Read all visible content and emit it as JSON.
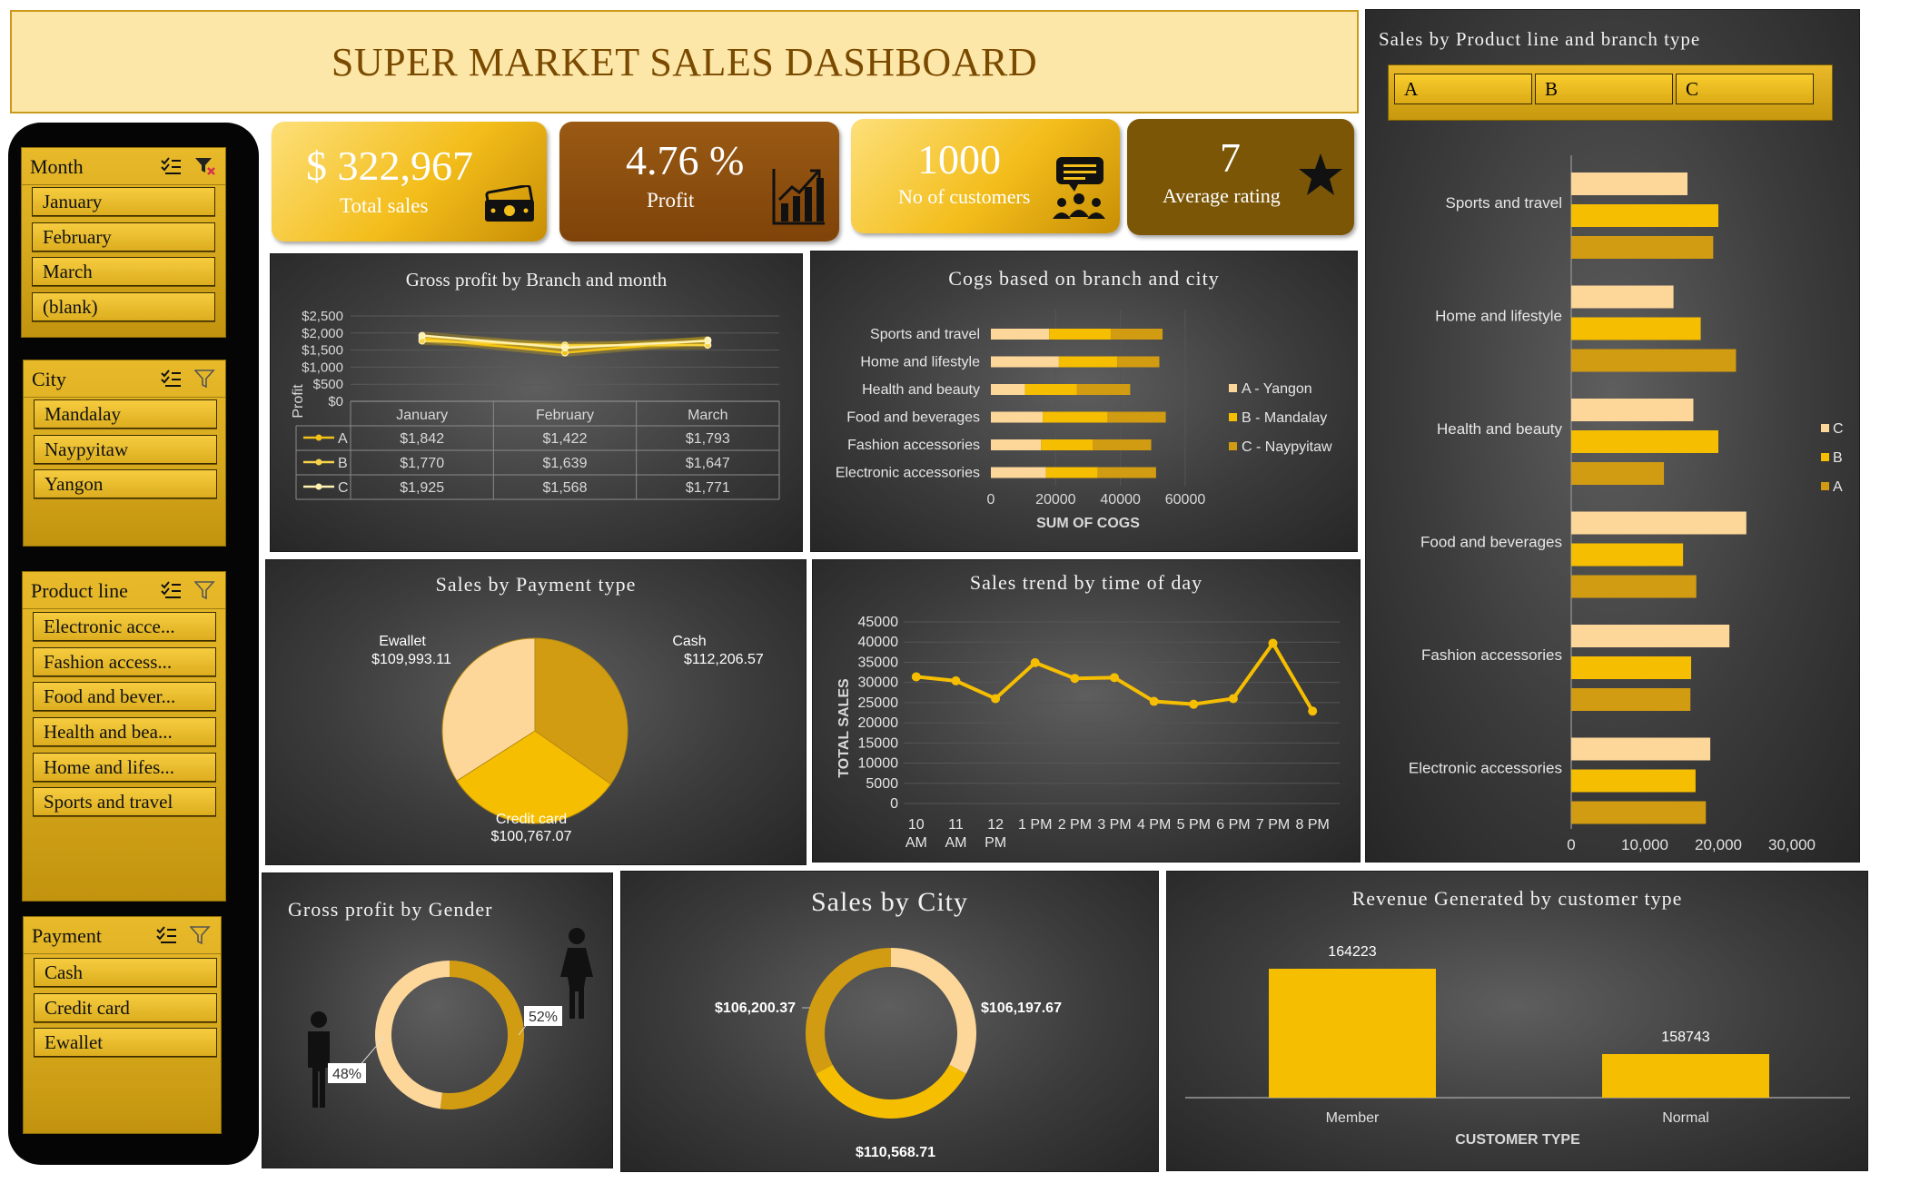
{
  "title": "SUPER MARKET SALES DASHBOARD",
  "slicers": {
    "month": {
      "title": "Month",
      "items": [
        "January",
        "February",
        "March",
        "(blank)"
      ]
    },
    "city": {
      "title": "City",
      "items": [
        "Mandalay",
        "Naypyitaw",
        "Yangon"
      ]
    },
    "product_line": {
      "title": "Product line",
      "items": [
        "Electronic acce...",
        "Fashion access...",
        "Food and bever...",
        "Health and bea...",
        "Home and lifes...",
        "Sports and travel"
      ]
    },
    "payment": {
      "title": "Payment",
      "items": [
        "Cash",
        "Credit card",
        "Ewallet"
      ]
    }
  },
  "kpis": {
    "total_sales": {
      "value": "$ 322,967",
      "label": "Total sales"
    },
    "profit": {
      "value": "4.76 %",
      "label": "Profit"
    },
    "customers": {
      "value": "1000",
      "label": "No of customers"
    },
    "rating": {
      "value": "7",
      "label": "Average rating"
    }
  },
  "colors": {
    "light": "#fdd79a",
    "mid": "#f6be00",
    "dark": "#d29c12",
    "title_text": "#7a4a00"
  },
  "chart_data": [
    {
      "id": "gross_profit_branch_month",
      "type": "line",
      "title": "Gross profit by Branch and month",
      "ylabel": "Profit",
      "categories": [
        "January",
        "February",
        "March"
      ],
      "yticks": [
        "$2,500",
        "$2,000",
        "$1,500",
        "$1,000",
        "$500",
        "$0"
      ],
      "ylim": [
        0,
        2500
      ],
      "series": [
        {
          "name": "A",
          "values": [
            1842,
            1422,
            1793
          ],
          "labels": [
            "$1,842",
            "$1,422",
            "$1,793"
          ]
        },
        {
          "name": "B",
          "values": [
            1770,
            1639,
            1647
          ],
          "labels": [
            "$1,770",
            "$1,639",
            "$1,647"
          ]
        },
        {
          "name": "C",
          "values": [
            1925,
            1568,
            1771
          ],
          "labels": [
            "$1,925",
            "$1,568",
            "$1,771"
          ]
        }
      ]
    },
    {
      "id": "cogs_branch_city",
      "type": "bar",
      "orientation": "horizontal",
      "stacked": true,
      "title": "Cogs based on branch and city",
      "xlabel": "SUM OF COGS",
      "categories": [
        "Sports and travel",
        "Home and lifestyle",
        "Health and beauty",
        "Food and beverages",
        "Fashion accessories",
        "Electronic accessories"
      ],
      "xticks": [
        "0",
        "20000",
        "40000",
        "60000"
      ],
      "xlim": [
        0,
        60000
      ],
      "legend_position": "right",
      "series": [
        {
          "name": "A - Yangon",
          "values": [
            18000,
            21000,
            10500,
            16000,
            15500,
            17000
          ]
        },
        {
          "name": "B - Mandalay",
          "values": [
            19000,
            18000,
            16000,
            20000,
            16000,
            16000
          ]
        },
        {
          "name": "C - Naypyitaw",
          "values": [
            16000,
            13000,
            16500,
            18000,
            18000,
            18000
          ]
        }
      ]
    },
    {
      "id": "sales_payment_type",
      "type": "pie",
      "title": "Sales by Payment type",
      "slices": [
        {
          "name": "Cash",
          "value": 112206.57,
          "label": "$112,206.57"
        },
        {
          "name": "Credit card",
          "value": 100767.07,
          "label": "$100,767.07"
        },
        {
          "name": "Ewallet",
          "value": 109993.11,
          "label": "$109,993.11"
        }
      ]
    },
    {
      "id": "sales_trend_time",
      "type": "line",
      "title": "Sales trend by time of day",
      "ylabel": "TOTAL SALES",
      "categories": [
        "10 AM",
        "11 AM",
        "12 PM",
        "1 PM",
        "2 PM",
        "3 PM",
        "4 PM",
        "5 PM",
        "6 PM",
        "7 PM",
        "8 PM"
      ],
      "yticks": [
        "45000",
        "40000",
        "35000",
        "30000",
        "25000",
        "20000",
        "15000",
        "10000",
        "5000",
        "0"
      ],
      "ylim": [
        0,
        45000
      ],
      "values": [
        31400,
        30400,
        26000,
        34900,
        31000,
        31200,
        25300,
        24600,
        26000,
        39700,
        22900
      ]
    },
    {
      "id": "sales_product_branch",
      "type": "bar",
      "orientation": "horizontal",
      "title": "Sales by Product line and branch type",
      "filter_buttons": [
        "A",
        "B",
        "C"
      ],
      "categories": [
        "Sports and travel",
        "Home and lifestyle",
        "Health and beauty",
        "Food and beverages",
        "Fashion accessories",
        "Electronic accessories"
      ],
      "xticks": [
        "0",
        "10,000",
        "20,000",
        "30,000"
      ],
      "xlim": [
        0,
        34000
      ],
      "legend_position": "right",
      "series": [
        {
          "name": "C",
          "values": [
            15800,
            13900,
            16600,
            23800,
            21500,
            18900
          ]
        },
        {
          "name": "B",
          "values": [
            20000,
            17600,
            20000,
            15200,
            16300,
            16900
          ]
        },
        {
          "name": "A",
          "values": [
            19300,
            22400,
            12600,
            17000,
            16200,
            18300
          ]
        }
      ]
    },
    {
      "id": "gross_profit_gender",
      "type": "pie",
      "donut": true,
      "title": "Gross profit by Gender",
      "slices": [
        {
          "name": "Female",
          "value": 52,
          "label": "52%"
        },
        {
          "name": "Male",
          "value": 48,
          "label": "48%"
        }
      ]
    },
    {
      "id": "sales_by_city",
      "type": "pie",
      "donut": true,
      "title": "Sales by City",
      "slices": [
        {
          "name": "Yangon",
          "value": 106197.67,
          "label": "$106,197.67"
        },
        {
          "name": "Naypyitaw",
          "value": 110568.71,
          "label": "$110,568.71"
        },
        {
          "name": "Mandalay",
          "value": 106200.37,
          "label": "$106,200.37"
        }
      ]
    },
    {
      "id": "revenue_customer_type",
      "type": "bar",
      "title": "Revenue Generated by customer type",
      "xlabel": "CUSTOMER TYPE",
      "categories": [
        "Member",
        "Normal"
      ],
      "values": [
        164223,
        158743
      ],
      "value_labels": [
        "164223",
        "158743"
      ]
    }
  ]
}
